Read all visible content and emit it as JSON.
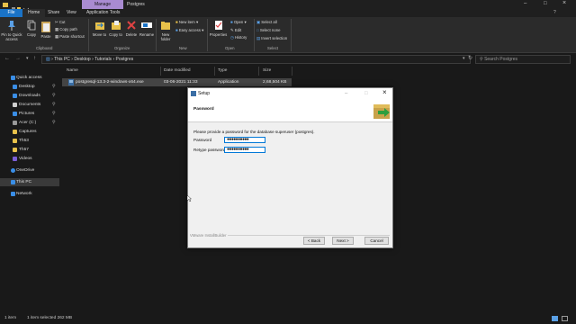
{
  "window": {
    "title": "Postgres",
    "context_tab": "Manage"
  },
  "tabs": [
    {
      "label": "File"
    },
    {
      "label": "Home"
    },
    {
      "label": "Share"
    },
    {
      "label": "View"
    },
    {
      "label": "Application Tools"
    }
  ],
  "ribbon": {
    "pin_label": "Pin to Quick access",
    "copy_label": "Copy",
    "paste_label": "Paste",
    "cut_label": "Cut",
    "copy_path_label": "Copy path",
    "paste_shortcut_label": "Paste shortcut",
    "move_to_label": "Move to",
    "copy_to_label": "Copy to",
    "delete_label": "Delete",
    "rename_label": "Rename",
    "new_folder_label": "New folder",
    "new_item_label": "New item",
    "easy_access_label": "Easy access",
    "properties_label": "Properties",
    "open_label": "Open",
    "edit_label": "Edit",
    "history_label": "History",
    "select_all_label": "Select all",
    "select_none_label": "Select none",
    "invert_selection_label": "Invert selection",
    "groups": {
      "clipboard": "Clipboard",
      "organize": "Organize",
      "new": "New",
      "open": "Open",
      "select": "Select"
    }
  },
  "address": {
    "breadcrumb": [
      "This PC",
      "Desktop",
      "Tutorials",
      "Postgres"
    ],
    "search_placeholder": "Search Postgres"
  },
  "nav": {
    "items": [
      {
        "label": "Quick access",
        "color": "#3a8ee6"
      },
      {
        "label": "Desktop",
        "color": "#3a8ee6"
      },
      {
        "label": "Downloads",
        "color": "#3a8ee6"
      },
      {
        "label": "Documents",
        "color": "#cfcfcf"
      },
      {
        "label": "Pictures",
        "color": "#3a8ee6"
      },
      {
        "label": "Acer (C:)",
        "color": "#9a9a9a"
      },
      {
        "label": "Captures",
        "color": "#e8c14a"
      },
      {
        "label": "Th53",
        "color": "#e8c14a"
      },
      {
        "label": "Th57",
        "color": "#e8c14a"
      },
      {
        "label": "Videos",
        "color": "#7b5fd6"
      },
      {
        "label": "OneDrive",
        "color": "#3a8ee6"
      },
      {
        "label": "This PC",
        "color": "#3a8ee6"
      },
      {
        "label": "Network",
        "color": "#3a8ee6"
      }
    ]
  },
  "columns": {
    "name": "Name",
    "date": "Date modified",
    "type": "Type",
    "size": "Size"
  },
  "files": [
    {
      "name": "postgresql-13.3-2-windows-x64.exe",
      "date": "03-06-2021 11:33",
      "type": "Application",
      "size": "2,68,504 KB"
    }
  ],
  "status": {
    "count": "1 item",
    "selected": "1 item selected  262 MB"
  },
  "dialog": {
    "title": "Setup",
    "header": "Password",
    "instruction": "Please provide a password for the database superuser (postgres).",
    "password_label": "Password",
    "password_value": "●●●●●●●●●●",
    "retype_label": "Retype password",
    "retype_value": "●●●●●●●●●●",
    "footer_brand": "VMware InstallBuilder",
    "back_label": "< Back",
    "next_label": "Next >",
    "cancel_label": "Cancel"
  },
  "colors": {
    "accent": "#0078d7",
    "manage_tab": "#a98bd1"
  }
}
